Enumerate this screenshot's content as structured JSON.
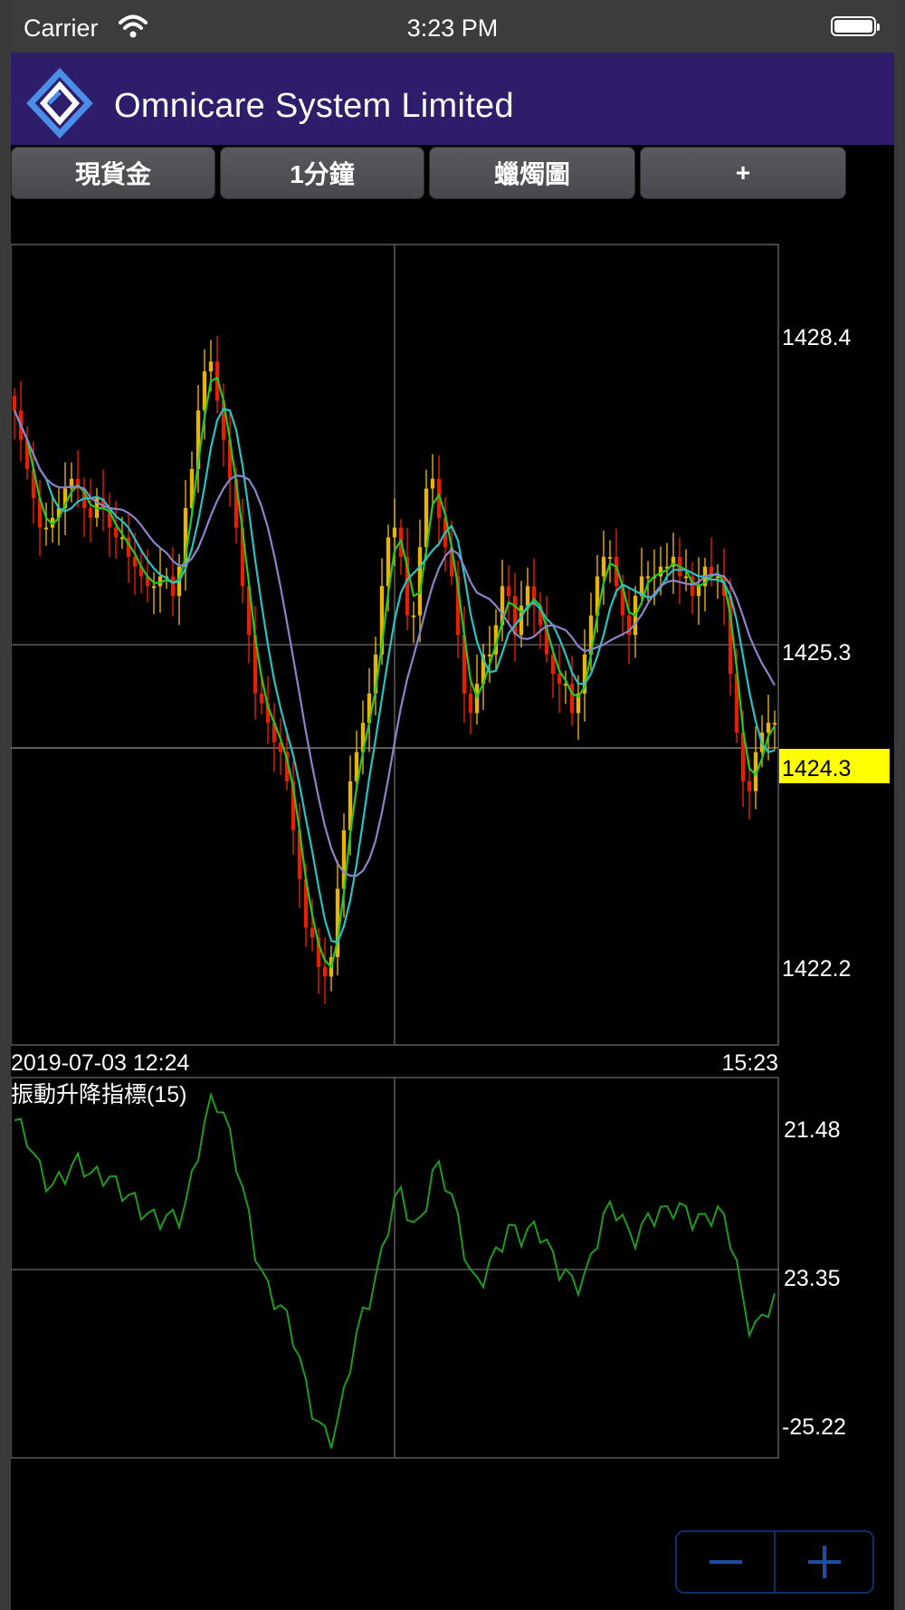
{
  "status_bar": {
    "carrier": "Carrier",
    "time": "3:23 PM"
  },
  "header": {
    "title": "Omnicare System Limited"
  },
  "toolbar": {
    "buttons": [
      "現貨金",
      "1分鐘",
      "蠟燭圖",
      "+"
    ]
  },
  "chart_data": [
    {
      "type": "candlestick",
      "y_ticks": [
        "1428.4",
        "1425.3",
        "1422.2"
      ],
      "last_price": "1424.3",
      "last_price_color": "#ffff00",
      "x_start_label": "2019-07-03 12:24",
      "x_end_label": "15:23",
      "ylim": [
        1421.0,
        1429.2
      ],
      "close": [
        1427.5,
        1427.2,
        1426.9,
        1426.6,
        1426.3,
        1426.3,
        1426.4,
        1426.5,
        1426.7,
        1426.8,
        1426.7,
        1426.5,
        1426.4,
        1426.6,
        1426.5,
        1426.3,
        1426.2,
        1426.2,
        1426.0,
        1425.9,
        1425.8,
        1425.7,
        1425.7,
        1425.8,
        1425.8,
        1425.6,
        1425.9,
        1426.5,
        1426.9,
        1427.5,
        1427.9,
        1428.0,
        1427.6,
        1427.2,
        1426.8,
        1426.3,
        1425.7,
        1425.2,
        1424.6,
        1424.5,
        1424.3,
        1424.1,
        1424.0,
        1423.7,
        1423.2,
        1422.7,
        1422.2,
        1422.1,
        1421.8,
        1421.7,
        1421.9,
        1422.6,
        1423.2,
        1423.7,
        1424.0,
        1424.3,
        1424.6,
        1425.0,
        1425.7,
        1426.2,
        1426.3,
        1426.0,
        1425.4,
        1425.4,
        1426.1,
        1426.7,
        1426.8,
        1426.4,
        1426.1,
        1425.8,
        1425.2,
        1424.6,
        1424.4,
        1424.7,
        1425.0,
        1425.0,
        1425.3,
        1425.7,
        1425.6,
        1425.2,
        1425.5,
        1425.7,
        1425.5,
        1425.3,
        1425.0,
        1424.8,
        1424.7,
        1424.7,
        1424.4,
        1424.6,
        1425.0,
        1425.4,
        1425.8,
        1426.0,
        1426.0,
        1425.7,
        1425.4,
        1425.2,
        1425.6,
        1425.8,
        1425.8,
        1425.8,
        1425.9,
        1425.9,
        1426.0,
        1425.8,
        1425.8,
        1425.6,
        1425.7,
        1425.9,
        1425.8,
        1425.8,
        1425.6,
        1424.8,
        1424.2,
        1423.7,
        1423.6,
        1424.0,
        1424.2,
        1424.3,
        1424.3
      ],
      "indicator": {
        "title": "振動升降指標(15)",
        "y_ticks": [
          "21.48",
          "23.35",
          "-25.22"
        ],
        "series_color": "#1f9b1f"
      },
      "colors": {
        "candle_up": "#e8b400",
        "candle_down": "#e81e00",
        "ma_fast": "#22cc22",
        "ma_mid": "#25c4c4",
        "ma_slow": "#8a85c8",
        "grid": "#5a5a5a"
      }
    }
  ],
  "zoom": {
    "minus_icon": "minus-icon",
    "plus_icon": "plus-icon"
  }
}
